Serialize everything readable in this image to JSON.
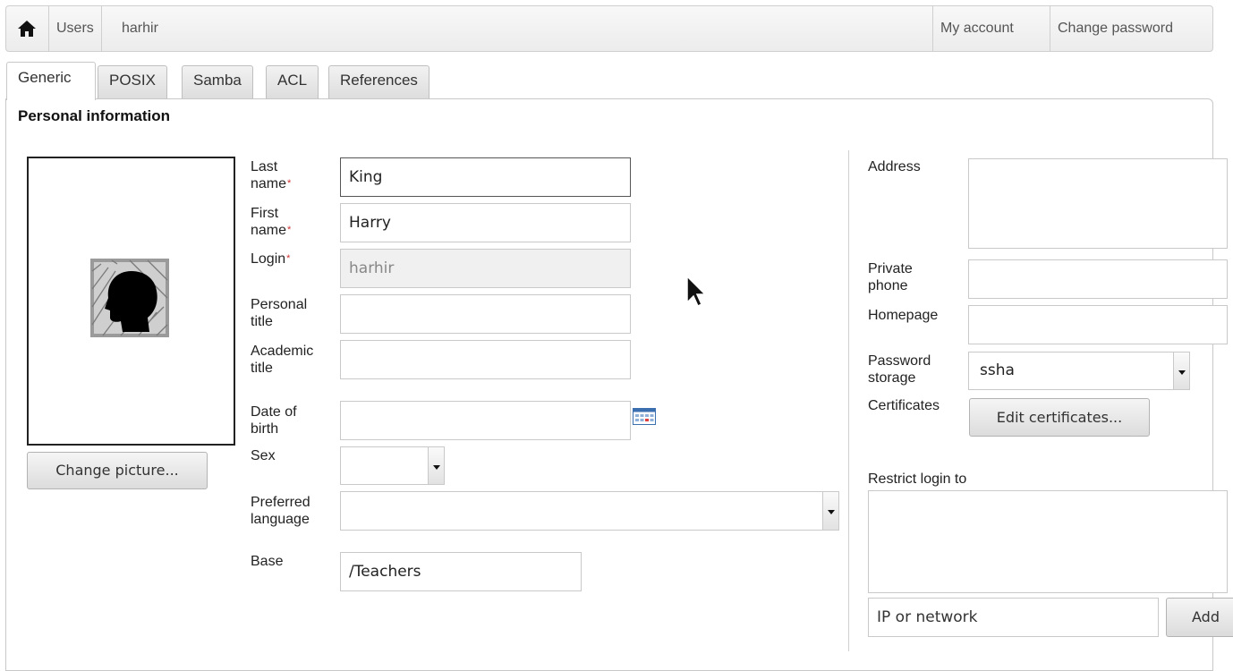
{
  "topbar": {
    "home_icon": "home-icon",
    "breadcrumb": [
      "Users",
      "harhir"
    ],
    "my_account": "My account",
    "change_password": "Change password"
  },
  "tabs": [
    {
      "label": "Generic",
      "active": true
    },
    {
      "label": "POSIX",
      "active": false
    },
    {
      "label": "Samba",
      "active": false
    },
    {
      "label": "ACL",
      "active": false
    },
    {
      "label": "References",
      "active": false
    }
  ],
  "section_title": "Personal information",
  "picture": {
    "icon": "user-silhouette-icon",
    "change_button": "Change picture..."
  },
  "form": {
    "last_name": {
      "label_1": "Last",
      "label_2": "name",
      "required": "*",
      "value": "King"
    },
    "first_name": {
      "label_1": "First",
      "label_2": "name",
      "required": "*",
      "value": "Harry"
    },
    "login": {
      "label": "Login",
      "required": "*",
      "value": "harhir"
    },
    "personal_title": {
      "label_1": "Personal",
      "label_2": "title",
      "value": ""
    },
    "academic_title": {
      "label_1": "Academic",
      "label_2": "title",
      "value": ""
    },
    "date_of_birth": {
      "label_1": "Date of",
      "label_2": "birth",
      "value": "",
      "icon": "calendar-icon"
    },
    "sex": {
      "label": "Sex",
      "value": ""
    },
    "preferred_language": {
      "label_1": "Preferred",
      "label_2": "language",
      "value": ""
    },
    "base": {
      "label": "Base",
      "value": "/Teachers"
    }
  },
  "right": {
    "address": {
      "label": "Address",
      "value": ""
    },
    "private_phone": {
      "label_1": "Private",
      "label_2": "phone",
      "value": ""
    },
    "homepage": {
      "label": "Homepage",
      "value": ""
    },
    "password_storage": {
      "label_1": "Password",
      "label_2": "storage",
      "value": "ssha"
    },
    "certificates": {
      "label": "Certificates",
      "button": "Edit certificates..."
    },
    "restrict_login": {
      "label": "Restrict login to",
      "placeholder": "IP or network",
      "add_button": "Add"
    }
  },
  "colors": {
    "required": "#d03030",
    "border": "#c9c9c9"
  }
}
